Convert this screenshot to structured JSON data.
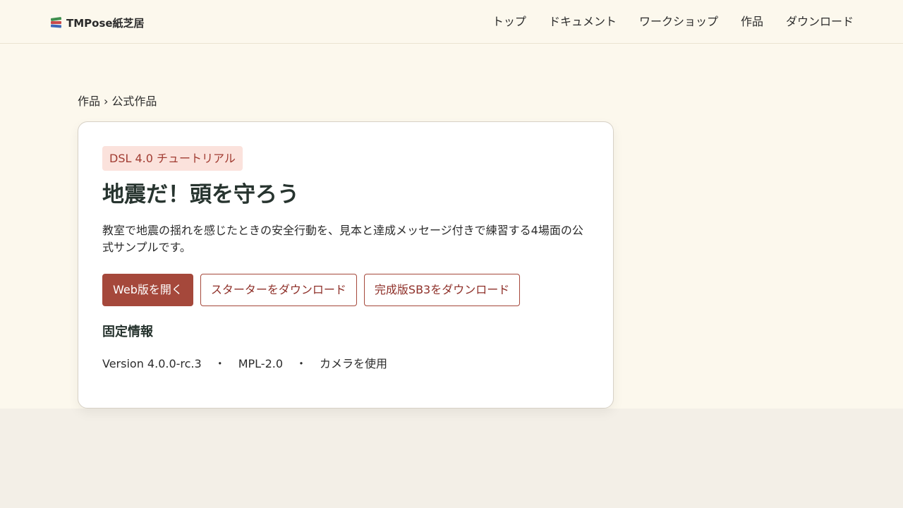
{
  "header": {
    "brand": "TMPose紙芝居",
    "brand_icon": "books-icon",
    "nav": [
      "トップ",
      "ドキュメント",
      "ワークショップ",
      "作品",
      "ダウンロード"
    ]
  },
  "breadcrumb": {
    "parent": "作品",
    "separator": "›",
    "current": "公式作品"
  },
  "card": {
    "tag": "DSL 4.0 チュートリアル",
    "title": "地震だ！頭を守ろう",
    "description": "教室で地震の揺れを感じたときの安全行動を、見本と達成メッセージ付きで練習する4場面の公式サンプルです。",
    "buttons": {
      "open_web": "Web版を開く",
      "download_starter": "スターターをダウンロード",
      "download_complete": "完成版SB3をダウンロード"
    },
    "section_title": "固定情報",
    "meta": {
      "version": "Version 4.0.0-rc.3",
      "dot": "・",
      "license": "MPL-2.0",
      "camera": "カメラを使用"
    }
  },
  "colors": {
    "accent": "#a5483b",
    "tag_bg": "#fbe2dc",
    "page_bg": "#fcf8ed"
  }
}
